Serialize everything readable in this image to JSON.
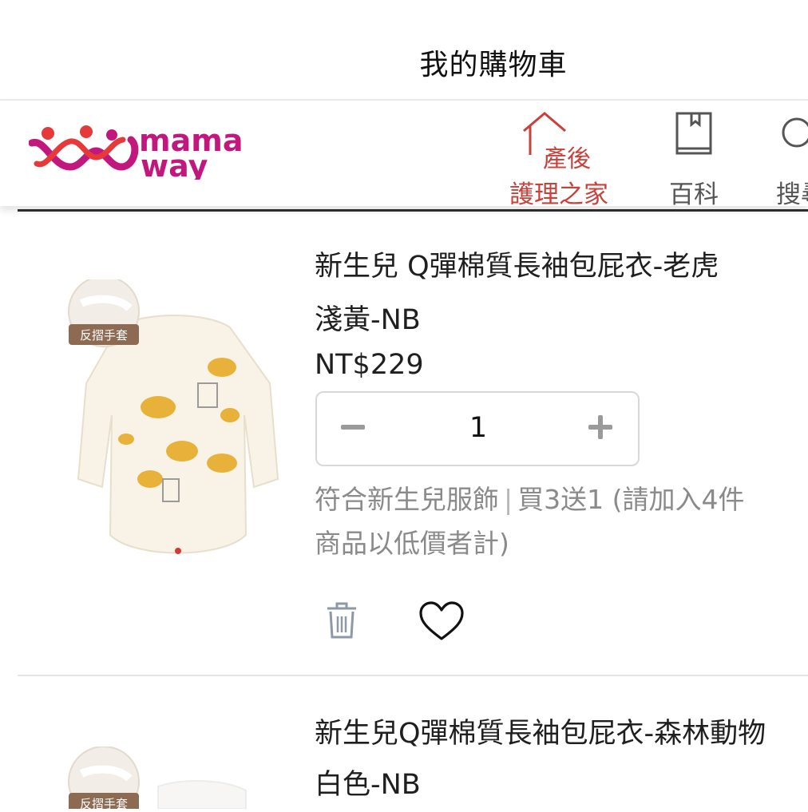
{
  "header": {
    "page_title": "我的購物車",
    "brand": {
      "line1": "mama",
      "line2": "way"
    },
    "nav": [
      {
        "small": "產後",
        "label": "護理之家",
        "icon": "house-icon",
        "color": "#c9413b"
      },
      {
        "label": "百科",
        "icon": "book-icon"
      },
      {
        "label": "搜尋",
        "icon": "search-icon"
      }
    ]
  },
  "cart": {
    "items": [
      {
        "name": "新生兒 Q彈棉質長袖包屁衣-老虎",
        "variant": "淺黃-NB",
        "price": "NT$229",
        "quantity": "1",
        "badge": "反摺手套",
        "promo_category": "符合新生兒服飾",
        "promo_separator": "|",
        "promo_detail": "買3送1 (請加入4件",
        "promo_line2": "商品以低價者計)",
        "actions": {
          "delete_icon": "trash-icon",
          "favorite_icon": "heart-icon"
        }
      },
      {
        "name": "新生兒Q彈棉質長袖包屁衣-森林動物",
        "variant": "白色-NB",
        "badge": "反摺手套"
      }
    ]
  },
  "colors": {
    "brand_magenta": "#c2187e",
    "brand_red": "#e63a3a",
    "nav_active": "#c9413b"
  }
}
